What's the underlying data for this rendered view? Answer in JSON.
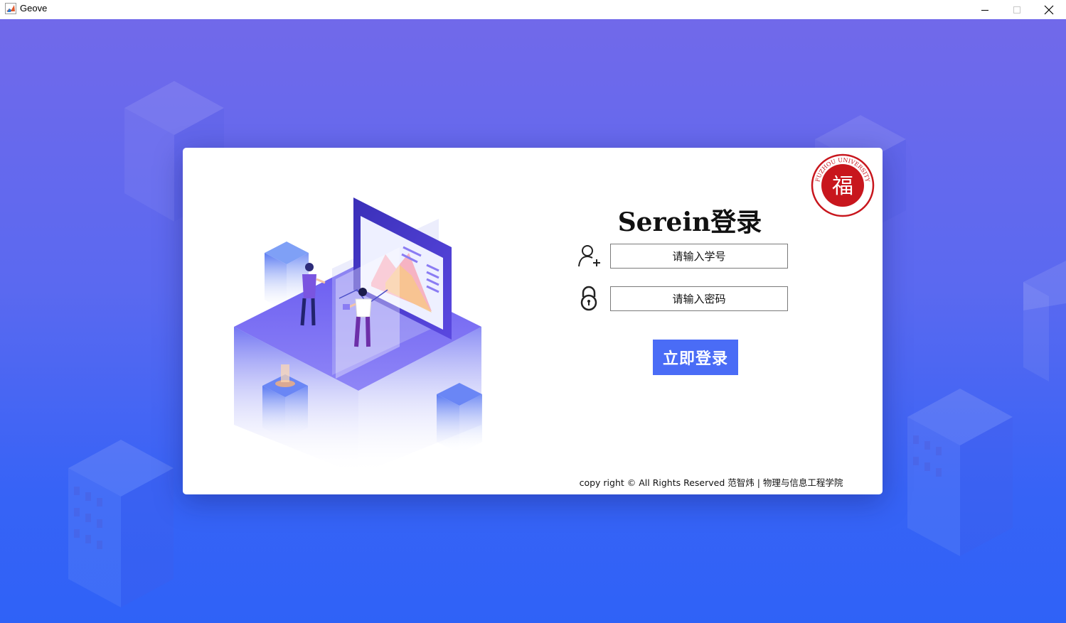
{
  "window": {
    "title": "Geove",
    "app_icon": "matlab-icon",
    "minimize_icon": "minimize-icon",
    "maximize_icon": "maximize-icon",
    "close_icon": "close-icon"
  },
  "login": {
    "title": "Serein登录",
    "username_placeholder": "请输入学号",
    "password_placeholder": "请输入密码",
    "submit_label": "立即登录",
    "user_icon": "user-add-icon",
    "lock_icon": "lock-icon"
  },
  "logo": {
    "name": "fuzhou-university-seal",
    "arc_text": "FUZHOU UNIVERSITY",
    "center_char": "福",
    "color": "#c8161d"
  },
  "footer": {
    "copyright": "copy right © All Rights Reserved 范智炜 | 物理与信息工程学院"
  },
  "colors": {
    "background_top": "#7169ea",
    "background_bottom": "#2f62f7",
    "button": "#4a6cf6",
    "card": "#ffffff"
  }
}
